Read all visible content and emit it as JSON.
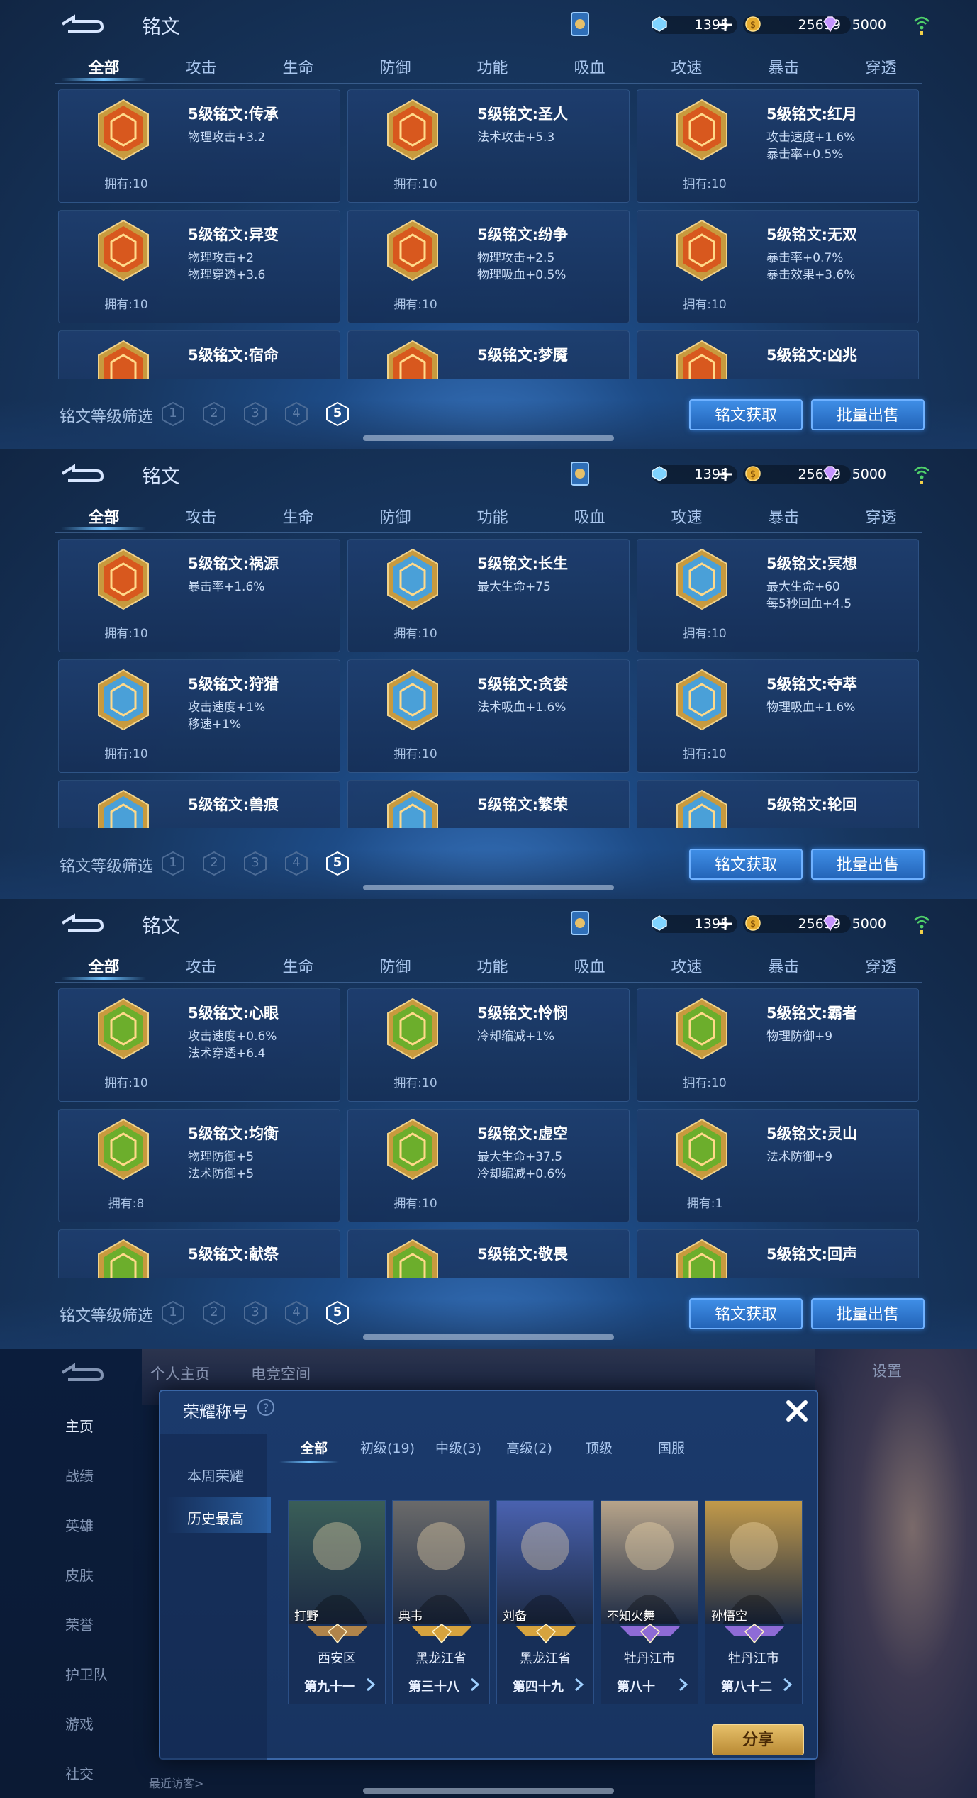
{
  "app": {
    "title": "铭文",
    "resources": {
      "diamond": "1395",
      "gold": "25659",
      "gem": "5000"
    },
    "tabs": [
      "全部",
      "攻击",
      "生命",
      "防御",
      "功能",
      "吸血",
      "攻速",
      "暴击",
      "穿透"
    ],
    "filter_label": "铭文等级筛选",
    "levels": [
      "1",
      "2",
      "3",
      "4",
      "5"
    ],
    "get_button": "铭文获取",
    "sell_button": "批量出售"
  },
  "pages": [
    {
      "cards": [
        {
          "name": "5级铭文:传承",
          "stats": [
            "物理攻击+3.2"
          ],
          "own": "拥有:10",
          "color": "#d8581e"
        },
        {
          "name": "5级铭文:圣人",
          "stats": [
            "法术攻击+5.3"
          ],
          "own": "拥有:10",
          "color": "#d8581e"
        },
        {
          "name": "5级铭文:红月",
          "stats": [
            "攻击速度+1.6%",
            "暴击率+0.5%"
          ],
          "own": "拥有:10",
          "color": "#d8581e"
        },
        {
          "name": "5级铭文:异变",
          "stats": [
            "物理攻击+2",
            "物理穿透+3.6"
          ],
          "own": "拥有:10",
          "color": "#d8581e"
        },
        {
          "name": "5级铭文:纷争",
          "stats": [
            "物理攻击+2.5",
            "物理吸血+0.5%"
          ],
          "own": "拥有:10",
          "color": "#d8581e"
        },
        {
          "name": "5级铭文:无双",
          "stats": [
            "暴击率+0.7%",
            "暴击效果+3.6%"
          ],
          "own": "拥有:10",
          "color": "#d8581e"
        },
        {
          "name": "5级铭文:宿命",
          "stats": [],
          "own": "",
          "color": "#d8581e"
        },
        {
          "name": "5级铭文:梦魇",
          "stats": [],
          "own": "",
          "color": "#d8581e"
        },
        {
          "name": "5级铭文:凶兆",
          "stats": [],
          "own": "",
          "color": "#d8581e"
        }
      ]
    },
    {
      "cards": [
        {
          "name": "5级铭文:祸源",
          "stats": [
            "暴击率+1.6%"
          ],
          "own": "拥有:10",
          "color": "#d8581e"
        },
        {
          "name": "5级铭文:长生",
          "stats": [
            "最大生命+75"
          ],
          "own": "拥有:10",
          "color": "#4aa0d8"
        },
        {
          "name": "5级铭文:冥想",
          "stats": [
            "最大生命+60",
            "每5秒回血+4.5"
          ],
          "own": "拥有:10",
          "color": "#4aa0d8"
        },
        {
          "name": "5级铭文:狩猎",
          "stats": [
            "攻击速度+1%",
            "移速+1%"
          ],
          "own": "拥有:10",
          "color": "#4aa0d8"
        },
        {
          "name": "5级铭文:贪婪",
          "stats": [
            "法术吸血+1.6%"
          ],
          "own": "拥有:10",
          "color": "#4aa0d8"
        },
        {
          "name": "5级铭文:夺萃",
          "stats": [
            "物理吸血+1.6%"
          ],
          "own": "拥有:10",
          "color": "#4aa0d8"
        },
        {
          "name": "5级铭文:兽痕",
          "stats": [],
          "own": "",
          "color": "#4aa0d8"
        },
        {
          "name": "5级铭文:繁荣",
          "stats": [],
          "own": "",
          "color": "#4aa0d8"
        },
        {
          "name": "5级铭文:轮回",
          "stats": [],
          "own": "",
          "color": "#4aa0d8"
        }
      ]
    },
    {
      "cards": [
        {
          "name": "5级铭文:心眼",
          "stats": [
            "攻击速度+0.6%",
            "法术穿透+6.4"
          ],
          "own": "拥有:10",
          "color": "#6cae2c"
        },
        {
          "name": "5级铭文:怜悯",
          "stats": [
            "冷却缩减+1%"
          ],
          "own": "拥有:10",
          "color": "#6cae2c"
        },
        {
          "name": "5级铭文:霸者",
          "stats": [
            "物理防御+9"
          ],
          "own": "拥有:10",
          "color": "#6cae2c"
        },
        {
          "name": "5级铭文:均衡",
          "stats": [
            "物理防御+5",
            "法术防御+5"
          ],
          "own": "拥有:8",
          "color": "#6cae2c"
        },
        {
          "name": "5级铭文:虚空",
          "stats": [
            "最大生命+37.5",
            "冷却缩减+0.6%"
          ],
          "own": "拥有:10",
          "color": "#6cae2c"
        },
        {
          "name": "5级铭文:灵山",
          "stats": [
            "法术防御+9"
          ],
          "own": "拥有:1",
          "color": "#6cae2c"
        },
        {
          "name": "5级铭文:献祭",
          "stats": [],
          "own": "",
          "color": "#6cae2c"
        },
        {
          "name": "5级铭文:敬畏",
          "stats": [],
          "own": "",
          "color": "#6cae2c"
        },
        {
          "name": "5级铭文:回声",
          "stats": [],
          "own": "",
          "color": "#6cae2c"
        }
      ]
    }
  ],
  "honor": {
    "topnav": [
      "个人主页",
      "电竞空间"
    ],
    "settings": "设置",
    "sidebar": [
      "主页",
      "战绩",
      "英雄",
      "皮肤",
      "荣誉",
      "护卫队",
      "游戏",
      "社交"
    ],
    "dialog_title": "荣耀称号",
    "dialog_side": [
      "本周荣耀",
      "历史最高"
    ],
    "tabs": [
      "全部",
      "初级(19)",
      "中级(3)",
      "高级(2)",
      "顶级",
      "国服"
    ],
    "cards": [
      {
        "hero": "打野",
        "region": "西安区",
        "rank": "第九十一",
        "tier": "#b0844a",
        "bg": "#3a5e58"
      },
      {
        "hero": "典韦",
        "region": "黑龙江省",
        "rank": "第三十八",
        "tier": "#d6a33e",
        "bg": "#6a6a6a"
      },
      {
        "hero": "刘备",
        "region": "黑龙江省",
        "rank": "第四十九",
        "tier": "#d6a33e",
        "bg": "#4a62b0"
      },
      {
        "hero": "不知火舞",
        "region": "牡丹江市",
        "rank": "第八十",
        "tier": "#8e6bd6",
        "bg": "#b7a48a"
      },
      {
        "hero": "孙悟空",
        "region": "牡丹江市",
        "rank": "第八十二",
        "tier": "#8e6bd6",
        "bg": "#c29a4a"
      }
    ],
    "share": "分享",
    "bottom_text": "最近访客>"
  }
}
